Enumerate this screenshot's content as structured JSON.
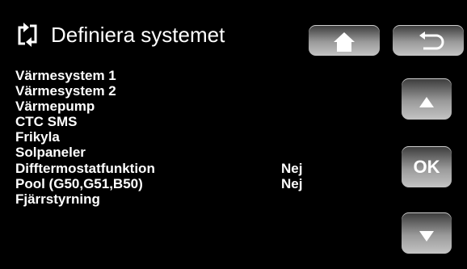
{
  "header": {
    "title": "Definiera systemet",
    "icon": "refresh-arrows-icon",
    "home_icon": "house-icon",
    "back_icon": "back-arrow-icon"
  },
  "menu": {
    "items": [
      {
        "label": "Värmesystem 1",
        "value": ""
      },
      {
        "label": "Värmesystem 2",
        "value": ""
      },
      {
        "label": "Värmepump",
        "value": ""
      },
      {
        "label": "CTC SMS",
        "value": ""
      },
      {
        "label": "Frikyla",
        "value": ""
      },
      {
        "label": "Solpaneler",
        "value": ""
      },
      {
        "label": "Difftermostatfunktion",
        "value": "Nej"
      },
      {
        "label": "Pool (G50,G51,B50)",
        "value": "Nej"
      },
      {
        "label": "Fjärrstyrning",
        "value": ""
      }
    ]
  },
  "controls": {
    "up_icon": "triangle-up-icon",
    "ok_label": "OK",
    "down_icon": "triangle-down-icon"
  },
  "colors": {
    "background": "#000000",
    "text": "#ffffff",
    "button": "#9a9a9a"
  }
}
